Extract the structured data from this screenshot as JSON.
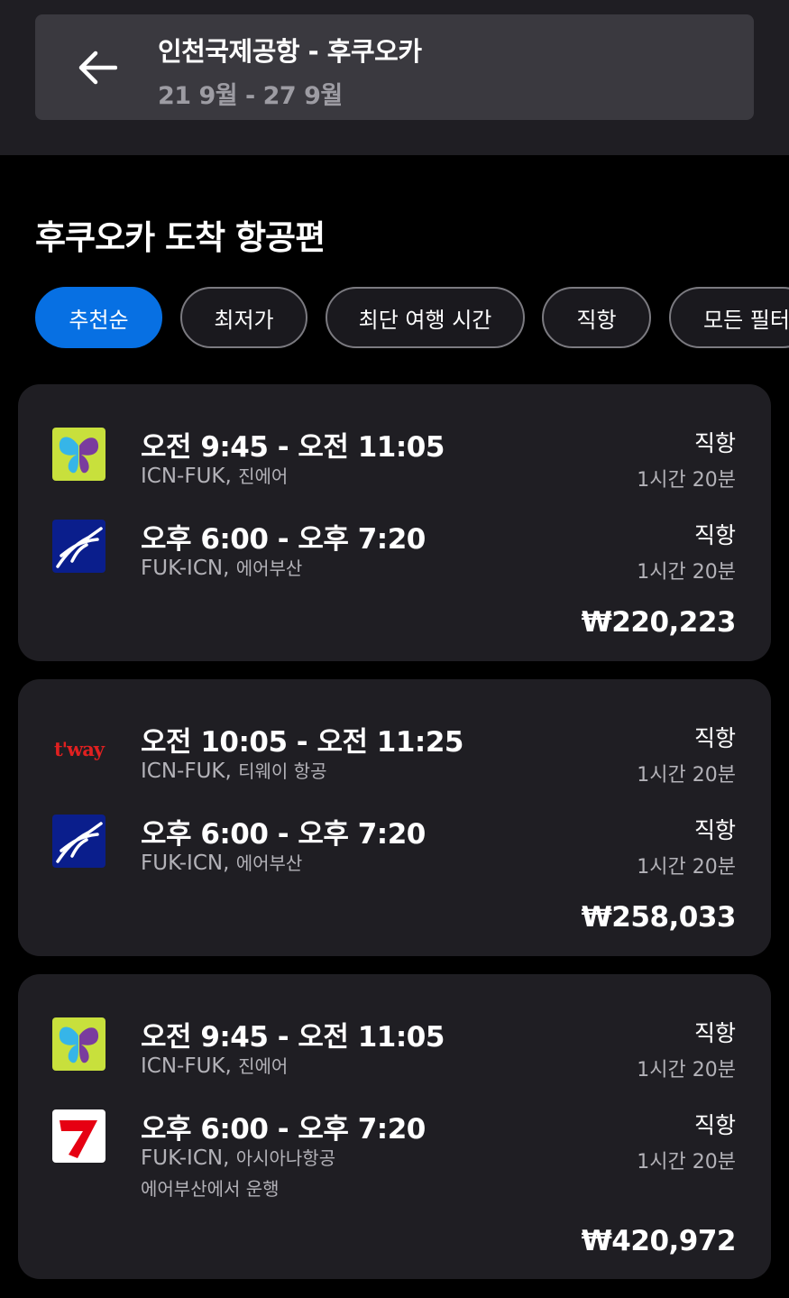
{
  "header": {
    "back_icon": "arrow-left-icon",
    "route": "인천국제공항 - 후쿠오카",
    "dates": "21 9월 - 27 9월"
  },
  "section_title": "후쿠오카 도착 항공편",
  "filters": [
    {
      "label": "추천순",
      "active": true
    },
    {
      "label": "최저가",
      "active": false
    },
    {
      "label": "최단 여행 시간",
      "active": false
    },
    {
      "label": "직항",
      "active": false
    },
    {
      "label": "모든 필터",
      "active": false
    }
  ],
  "results": [
    {
      "legs": [
        {
          "times": "오전 9:45 - 오전 11:05",
          "route": "ICN-FUK,",
          "carrier": "진에어",
          "stops": "직항",
          "duration": "1시간 20분",
          "logo": "jinair-logo"
        },
        {
          "times": "오후 6:00 - 오후 7:20",
          "route": "FUK-ICN,",
          "carrier": "에어부산",
          "stops": "직항",
          "duration": "1시간 20분",
          "logo": "airbusan-logo"
        }
      ],
      "price": "₩220,223"
    },
    {
      "legs": [
        {
          "times": "오전 10:05 - 오전 11:25",
          "route": "ICN-FUK,",
          "carrier": "티웨이 항공",
          "stops": "직항",
          "duration": "1시간 20분",
          "logo": "tway-logo",
          "logo_text": "t'way"
        },
        {
          "times": "오후 6:00 - 오후 7:20",
          "route": "FUK-ICN,",
          "carrier": "에어부산",
          "stops": "직항",
          "duration": "1시간 20분",
          "logo": "airbusan-logo"
        }
      ],
      "price": "₩258,033"
    },
    {
      "legs": [
        {
          "times": "오전 9:45 - 오전 11:05",
          "route": "ICN-FUK,",
          "carrier": "진에어",
          "stops": "직항",
          "duration": "1시간 20분",
          "logo": "jinair-logo"
        },
        {
          "times": "오후 6:00 - 오후 7:20",
          "route": "FUK-ICN,",
          "carrier": "아시아나항공",
          "stops": "직항",
          "duration": "1시간 20분",
          "logo": "asiana-logo",
          "operated_by": "에어부산에서 운행"
        }
      ],
      "price": "₩420,972"
    }
  ],
  "colors": {
    "accent": "#0770e3",
    "card_bg": "#1f1e23",
    "page_bg": "#000000"
  }
}
